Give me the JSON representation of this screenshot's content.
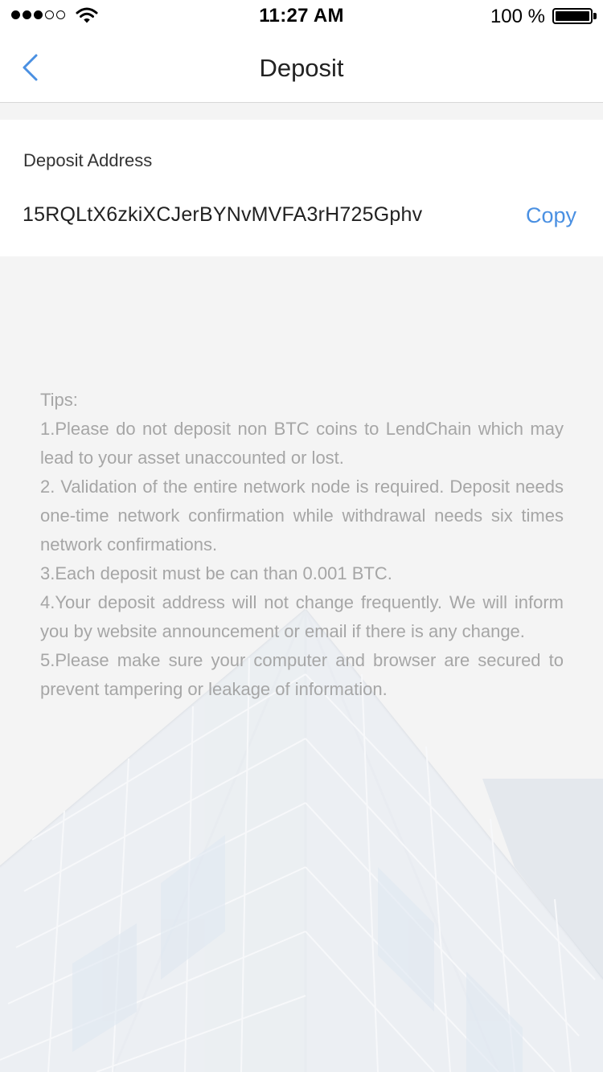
{
  "status_bar": {
    "time": "11:27 AM",
    "battery_percent": "100 %",
    "signal_strength": 3,
    "signal_max": 5,
    "icons": [
      "signal-icon",
      "wifi-icon",
      "battery-icon"
    ]
  },
  "nav": {
    "title": "Deposit",
    "back_icon": "chevron-left-icon",
    "accent_color": "#4a90e2"
  },
  "deposit": {
    "address_label": "Deposit Address",
    "address": "15RQLtX6zkiXCJerBYNvMVFA3rH725Gphv",
    "copy_label": "Copy"
  },
  "tips": {
    "heading": "Tips:",
    "items": [
      "1.Please do not deposit non BTC coins to LendChain which may lead to your asset unaccounted or lost.",
      "2.  Validation of the entire network node is required. Deposit needs one-time network confirmation while withdrawal needs six times network confirmations.",
      "3.Each deposit must be can than 0.001 BTC.",
      "4.Your deposit address will not change frequently. We will inform you by website announcement or email if there is any change.",
      "5.Please make sure your computer and browser are secured to prevent tampering or leakage of information."
    ]
  }
}
